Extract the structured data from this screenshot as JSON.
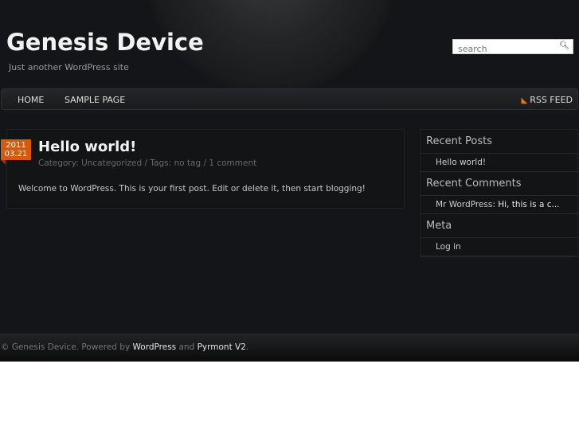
{
  "site": {
    "title": "Genesis Device",
    "tagline": "Just another WordPress site"
  },
  "search": {
    "placeholder": "search"
  },
  "nav": {
    "items": [
      "HOME",
      "SAMPLE PAGE"
    ],
    "rss": "RSS FEED"
  },
  "post": {
    "year": "2011",
    "date": "03.21",
    "title": "Hello world!",
    "meta": "Category: Uncategorized / Tags: no tag / 1 comment",
    "body": "Welcome to WordPress. This is your first post. Edit or delete it, then start blogging!"
  },
  "sidebar": {
    "recent_posts_title": "Recent Posts",
    "recent_posts": [
      "Hello world!"
    ],
    "recent_comments_title": "Recent Comments",
    "comment_author": "Mr WordPress",
    "comment_sep": ": ",
    "comment_excerpt": "Hi, this is a c...",
    "meta_title": "Meta",
    "meta_items": [
      "Log in"
    ]
  },
  "footer": {
    "copyright": "© Genesis Device. Powered by ",
    "wordpress": "WordPress",
    "and": " and ",
    "theme": "Pyrmont V2",
    "end": "."
  },
  "colors": {
    "accent": "#d55a0c",
    "background": "#141518"
  }
}
